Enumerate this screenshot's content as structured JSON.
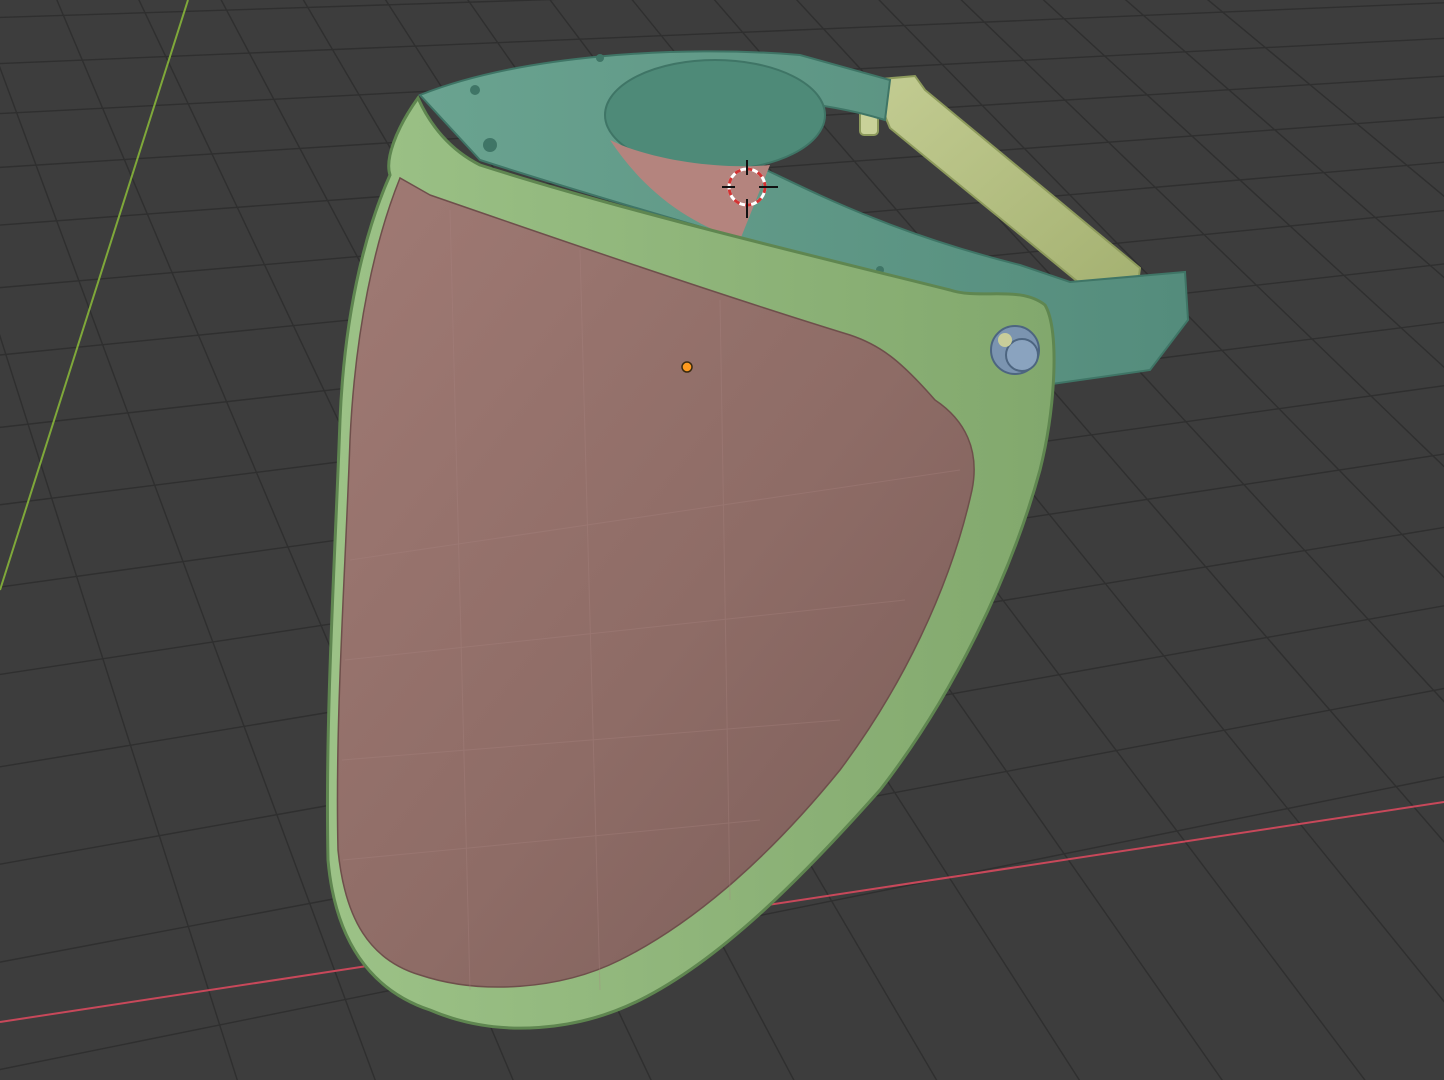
{
  "viewport": {
    "background_color": "#3d3d3d",
    "grid_line_color": "#2e2e2e",
    "x_axis_color": "#c8485a",
    "y_axis_color": "#7fa83a",
    "shield_color": "#9a7470",
    "frame_color": "#8fb37a",
    "headband_color": "#5f9a88",
    "strap_color": "#b8c48a",
    "knob_color": "#7b94b0",
    "origin_dot_color": "#ff9a1f",
    "cursor_color": "#d33333"
  },
  "scene": {
    "object": "face-shield-model",
    "has_3d_cursor": true,
    "has_origin_point": true,
    "grid_visible": true
  }
}
